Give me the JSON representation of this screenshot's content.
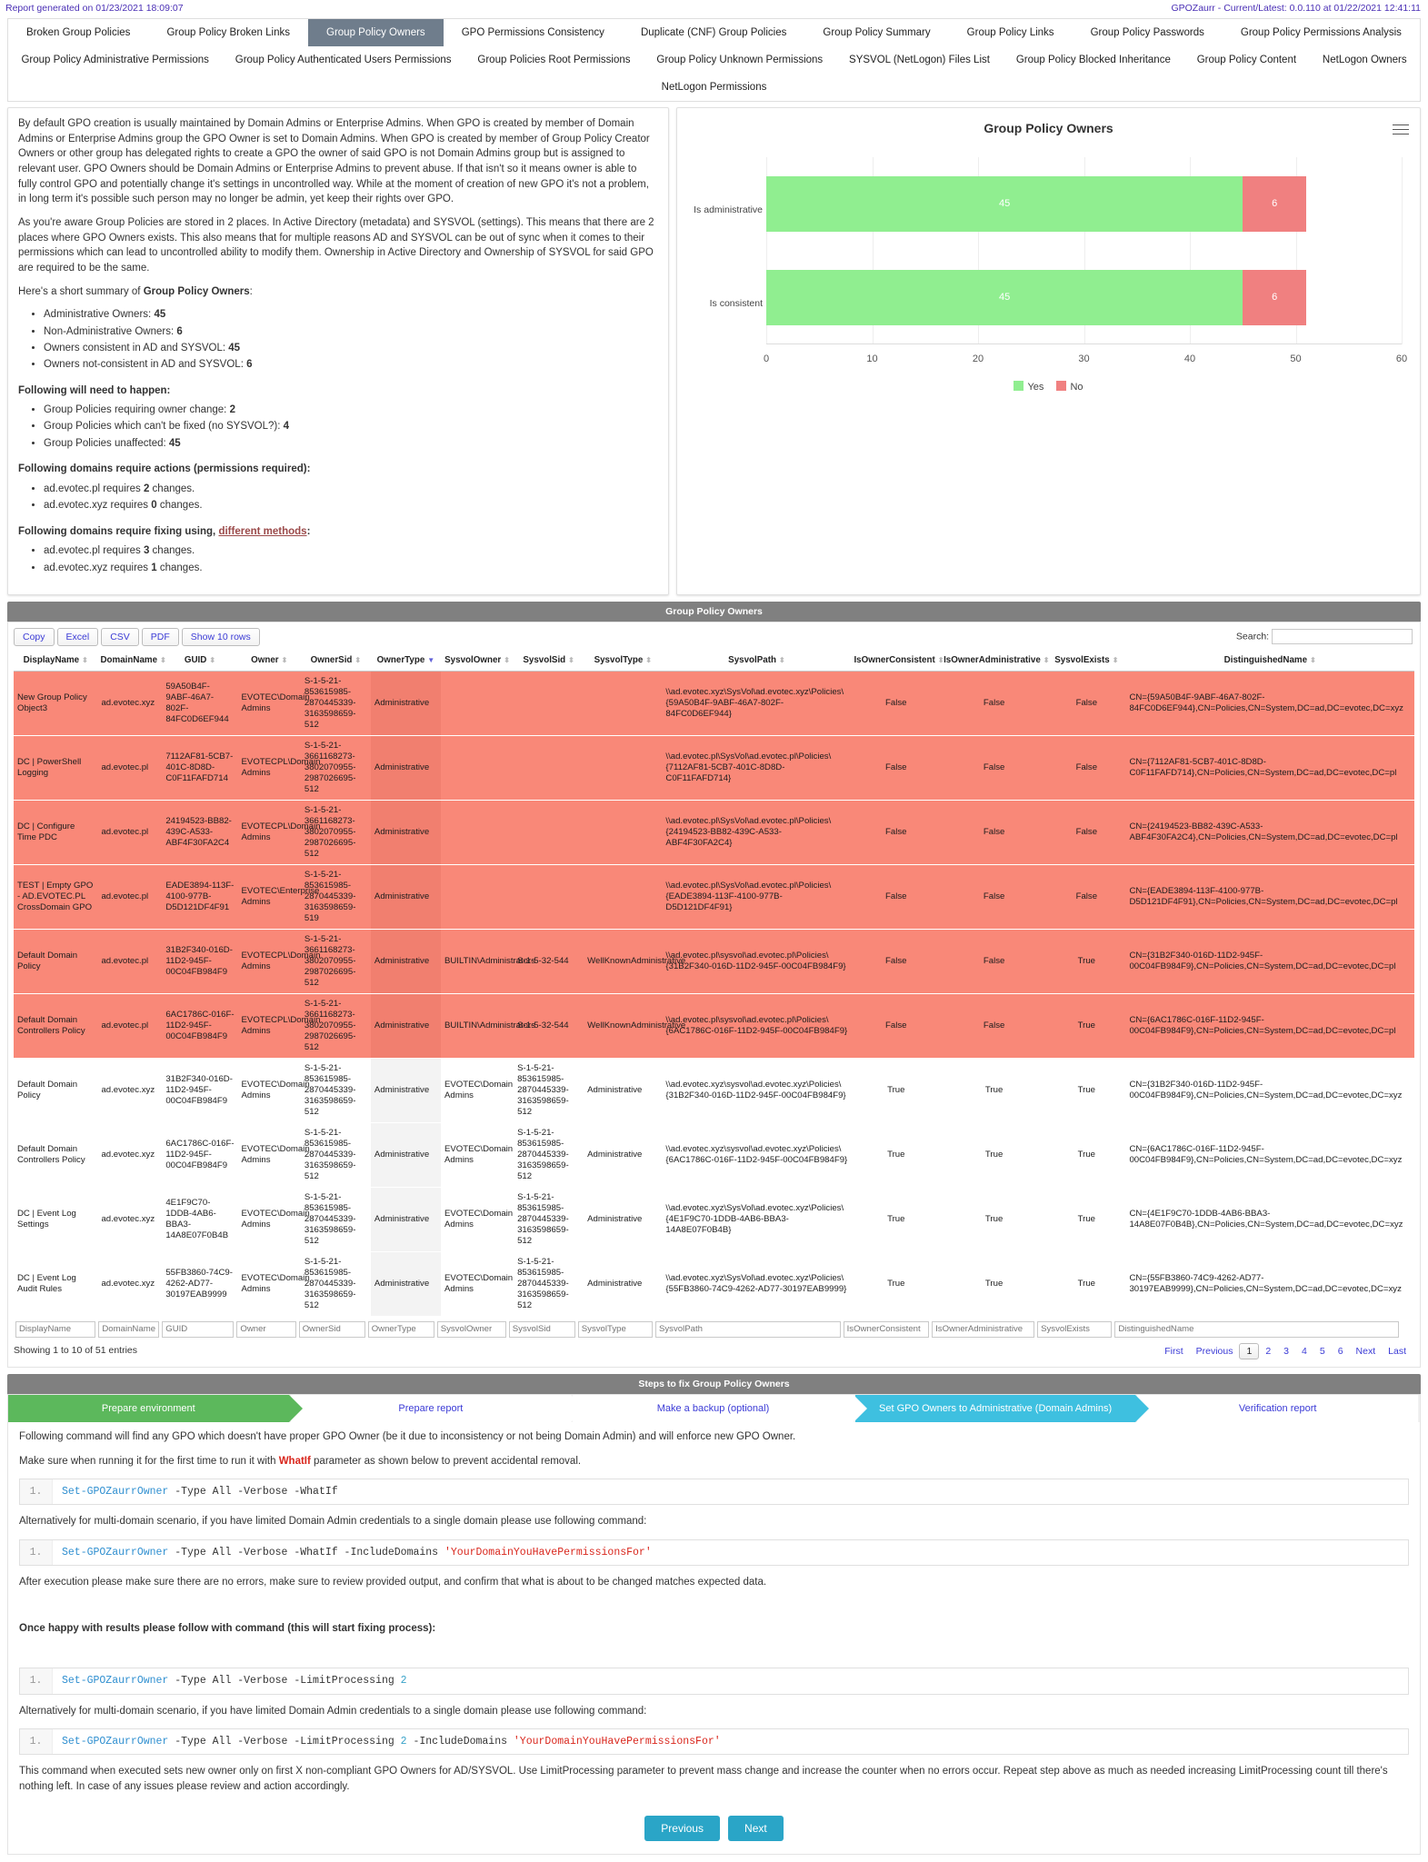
{
  "header": {
    "generated": "Report generated on 01/23/2021 18:09:07",
    "version": "GPOZaurr - Current/Latest: 0.0.110 at 01/22/2021 12:41:11"
  },
  "tabs": {
    "row1": [
      "Broken Group Policies",
      "Group Policy Broken Links",
      "Group Policy Owners",
      "GPO Permissions Consistency",
      "Duplicate (CNF) Group Policies",
      "Group Policy Summary",
      "Group Policy Links",
      "Group Policy Passwords",
      "Group Policy Permissions Analysis"
    ],
    "row2": [
      "Group Policy Administrative Permissions",
      "Group Policy Authenticated Users Permissions",
      "Group Policies Root Permissions",
      "Group Policy Unknown Permissions",
      "SYSVOL (NetLogon) Files List",
      "Group Policy Blocked Inheritance",
      "Group Policy Content",
      "NetLogon Owners"
    ],
    "row3": [
      "NetLogon Permissions"
    ],
    "active": "Group Policy Owners"
  },
  "description": {
    "p1": "By default GPO creation is usually maintained by Domain Admins or Enterprise Admins. When GPO is created by member of Domain Admins or Enterprise Admins group the GPO Owner is set to Domain Admins. When GPO is created by member of Group Policy Creator Owners or other group has delegated rights to create a GPO the owner of said GPO is not Domain Admins group but is assigned to relevant user. GPO Owners should be Domain Admins or Enterprise Admins to prevent abuse. If that isn't so it means owner is able to fully control GPO and potentially change it's settings in uncontrolled way. While at the moment of creation of new GPO it's not a problem, in long term it's possible such person may no longer be admin, yet keep their rights over GPO.",
    "p2": "As you're aware Group Policies are stored in 2 places. In Active Directory (metadata) and SYSVOL (settings). This means that there are 2 places where GPO Owners exists. This also means that for multiple reasons AD and SYSVOL can be out of sync when it comes to their permissions which can lead to uncontrolled ability to modify them. Ownership in Active Directory and Ownership of SYSVOL for said GPO are required to be the same.",
    "summary_lead": "Here's a short summary of ",
    "summary_bold": "Group Policy Owners",
    "summary_tail": ":",
    "summary_items": [
      {
        "label": "Administrative Owners: ",
        "value": "45"
      },
      {
        "label": "Non-Administrative Owners: ",
        "value": "6"
      },
      {
        "label": "Owners consistent in AD and SYSVOL: ",
        "value": "45"
      },
      {
        "label": "Owners not-consistent in AD and SYSVOL: ",
        "value": "6"
      }
    ],
    "happen_title": "Following will need to happen:",
    "happen_items": [
      {
        "label": "Group Policies requiring owner change: ",
        "value": "2"
      },
      {
        "label": "Group Policies which can't be fixed (no SYSVOL?): ",
        "value": "4"
      },
      {
        "label": "Group Policies unaffected: ",
        "value": "45"
      }
    ],
    "actions_title": "Following domains require actions (permissions required):",
    "actions_items": [
      {
        "pre": "ad.evotec.pl requires ",
        "value": "2",
        "post": " changes."
      },
      {
        "pre": "ad.evotec.xyz requires ",
        "value": "0",
        "post": " changes."
      }
    ],
    "fixing_title_pre": "Following domains require fixing using, ",
    "fixing_title_link": "different methods",
    "fixing_title_post": ":",
    "fixing_items": [
      {
        "pre": "ad.evotec.pl requires ",
        "value": "3",
        "post": " changes."
      },
      {
        "pre": "ad.evotec.xyz requires ",
        "value": "1",
        "post": " changes."
      }
    ]
  },
  "chart_data": {
    "type": "bar",
    "orientation": "horizontal",
    "stacked": true,
    "title": "Group Policy Owners",
    "categories": [
      "Is administrative",
      "Is consistent"
    ],
    "series": [
      {
        "name": "Yes",
        "color": "#90ee90",
        "values": [
          45,
          45
        ]
      },
      {
        "name": "No",
        "color": "#f08080",
        "values": [
          6,
          6
        ]
      }
    ],
    "xlabel": "",
    "ylabel": "",
    "xlim": [
      0,
      60
    ],
    "xticks": [
      0,
      10,
      20,
      30,
      40,
      50,
      60
    ],
    "grid": true,
    "legend_position": "bottom",
    "data_labels": [
      [
        "45",
        "6"
      ],
      [
        "45",
        "6"
      ]
    ]
  },
  "table": {
    "section_title": "Group Policy Owners",
    "buttons": [
      "Copy",
      "Excel",
      "CSV",
      "PDF",
      "Show 10 rows"
    ],
    "search_label": "Search:",
    "search_value": "",
    "columns": [
      "DisplayName",
      "DomainName",
      "GUID",
      "Owner",
      "OwnerSid",
      "OwnerType",
      "SysvolOwner",
      "SysvolSid",
      "SysvolType",
      "SysvolPath",
      "IsOwnerConsistent",
      "IsOwnerAdministrative",
      "SysvolExists",
      "DistinguishedName"
    ],
    "sorted_column": "OwnerType",
    "rows": [
      {
        "state": "bad",
        "cells": [
          "New Group Policy Object3",
          "ad.evotec.xyz",
          "59A50B4F-9ABF-46A7-802F-84FC0D6EF944",
          "EVOTEC\\Domain Admins",
          "S-1-5-21-853615985-2870445339-3163598659-512",
          "Administrative",
          "",
          "",
          "",
          "\\\\ad.evotec.xyz\\SysVol\\ad.evotec.xyz\\Policies\\{59A50B4F-9ABF-46A7-802F-84FC0D6EF944}",
          "False",
          "False",
          "False",
          "CN={59A50B4F-9ABF-46A7-802F-84FC0D6EF944},CN=Policies,CN=System,DC=ad,DC=evotec,DC=xyz"
        ]
      },
      {
        "state": "bad",
        "cells": [
          "DC | PowerShell Logging",
          "ad.evotec.pl",
          "7112AF81-5CB7-401C-8D8D-C0F11FAFD714",
          "EVOTECPL\\Domain Admins",
          "S-1-5-21-3661168273-3802070955-2987026695-512",
          "Administrative",
          "",
          "",
          "",
          "\\\\ad.evotec.pl\\SysVol\\ad.evotec.pl\\Policies\\{7112AF81-5CB7-401C-8D8D-C0F11FAFD714}",
          "False",
          "False",
          "False",
          "CN={7112AF81-5CB7-401C-8D8D-C0F11FAFD714},CN=Policies,CN=System,DC=ad,DC=evotec,DC=pl"
        ]
      },
      {
        "state": "bad",
        "cells": [
          "DC | Configure Time PDC",
          "ad.evotec.pl",
          "24194523-BB82-439C-A533-ABF4F30FA2C4",
          "EVOTECPL\\Domain Admins",
          "S-1-5-21-3661168273-3802070955-2987026695-512",
          "Administrative",
          "",
          "",
          "",
          "\\\\ad.evotec.pl\\SysVol\\ad.evotec.pl\\Policies\\{24194523-BB82-439C-A533-ABF4F30FA2C4}",
          "False",
          "False",
          "False",
          "CN={24194523-BB82-439C-A533-ABF4F30FA2C4},CN=Policies,CN=System,DC=ad,DC=evotec,DC=pl"
        ]
      },
      {
        "state": "bad",
        "cells": [
          "TEST | Empty GPO - AD.EVOTEC.PL CrossDomain GPO",
          "ad.evotec.pl",
          "EADE3894-113F-4100-977B-D5D121DF4F91",
          "EVOTEC\\Enterprise Admins",
          "S-1-5-21-853615985-2870445339-3163598659-519",
          "Administrative",
          "",
          "",
          "",
          "\\\\ad.evotec.pl\\SysVol\\ad.evotec.pl\\Policies\\{EADE3894-113F-4100-977B-D5D121DF4F91}",
          "False",
          "False",
          "False",
          "CN={EADE3894-113F-4100-977B-D5D121DF4F91},CN=Policies,CN=System,DC=ad,DC=evotec,DC=pl"
        ]
      },
      {
        "state": "bad",
        "cells": [
          "Default Domain Policy",
          "ad.evotec.pl",
          "31B2F340-016D-11D2-945F-00C04FB984F9",
          "EVOTECPL\\Domain Admins",
          "S-1-5-21-3661168273-3802070955-2987026695-512",
          "Administrative",
          "BUILTIN\\Administrators",
          "S-1-5-32-544",
          "WellKnownAdministrative",
          "\\\\ad.evotec.pl\\sysvol\\ad.evotec.pl\\Policies\\{31B2F340-016D-11D2-945F-00C04FB984F9}",
          "False",
          "False",
          "True",
          "CN={31B2F340-016D-11D2-945F-00C04FB984F9},CN=Policies,CN=System,DC=ad,DC=evotec,DC=pl"
        ]
      },
      {
        "state": "bad",
        "cells": [
          "Default Domain Controllers Policy",
          "ad.evotec.pl",
          "6AC1786C-016F-11D2-945F-00C04FB984F9",
          "EVOTECPL\\Domain Admins",
          "S-1-5-21-3661168273-3802070955-2987026695-512",
          "Administrative",
          "BUILTIN\\Administrators",
          "S-1-5-32-544",
          "WellKnownAdministrative",
          "\\\\ad.evotec.pl\\sysvol\\ad.evotec.pl\\Policies\\{6AC1786C-016F-11D2-945F-00C04FB984F9}",
          "False",
          "False",
          "True",
          "CN={6AC1786C-016F-11D2-945F-00C04FB984F9},CN=Policies,CN=System,DC=ad,DC=evotec,DC=pl"
        ]
      },
      {
        "state": "ok",
        "cells": [
          "Default Domain Policy",
          "ad.evotec.xyz",
          "31B2F340-016D-11D2-945F-00C04FB984F9",
          "EVOTEC\\Domain Admins",
          "S-1-5-21-853615985-2870445339-3163598659-512",
          "Administrative",
          "EVOTEC\\Domain Admins",
          "S-1-5-21-853615985-2870445339-3163598659-512",
          "Administrative",
          "\\\\ad.evotec.xyz\\sysvol\\ad.evotec.xyz\\Policies\\{31B2F340-016D-11D2-945F-00C04FB984F9}",
          "True",
          "True",
          "True",
          "CN={31B2F340-016D-11D2-945F-00C04FB984F9},CN=Policies,CN=System,DC=ad,DC=evotec,DC=xyz"
        ]
      },
      {
        "state": "ok",
        "cells": [
          "Default Domain Controllers Policy",
          "ad.evotec.xyz",
          "6AC1786C-016F-11D2-945F-00C04FB984F9",
          "EVOTEC\\Domain Admins",
          "S-1-5-21-853615985-2870445339-3163598659-512",
          "Administrative",
          "EVOTEC\\Domain Admins",
          "S-1-5-21-853615985-2870445339-3163598659-512",
          "Administrative",
          "\\\\ad.evotec.xyz\\sysvol\\ad.evotec.xyz\\Policies\\{6AC1786C-016F-11D2-945F-00C04FB984F9}",
          "True",
          "True",
          "True",
          "CN={6AC1786C-016F-11D2-945F-00C04FB984F9},CN=Policies,CN=System,DC=ad,DC=evotec,DC=xyz"
        ]
      },
      {
        "state": "ok",
        "cells": [
          "DC | Event Log Settings",
          "ad.evotec.xyz",
          "4E1F9C70-1DDB-4AB6-BBA3-14A8E07F0B4B",
          "EVOTEC\\Domain Admins",
          "S-1-5-21-853615985-2870445339-3163598659-512",
          "Administrative",
          "EVOTEC\\Domain Admins",
          "S-1-5-21-853615985-2870445339-3163598659-512",
          "Administrative",
          "\\\\ad.evotec.xyz\\SysVol\\ad.evotec.xyz\\Policies\\{4E1F9C70-1DDB-4AB6-BBA3-14A8E07F0B4B}",
          "True",
          "True",
          "True",
          "CN={4E1F9C70-1DDB-4AB6-BBA3-14A8E07F0B4B},CN=Policies,CN=System,DC=ad,DC=evotec,DC=xyz"
        ]
      },
      {
        "state": "ok",
        "cells": [
          "DC | Event Log Audit Rules",
          "ad.evotec.xyz",
          "55FB3860-74C9-4262-AD77-30197EAB9999",
          "EVOTEC\\Domain Admins",
          "S-1-5-21-853615985-2870445339-3163598659-512",
          "Administrative",
          "EVOTEC\\Domain Admins",
          "S-1-5-21-853615985-2870445339-3163598659-512",
          "Administrative",
          "\\\\ad.evotec.xyz\\SysVol\\ad.evotec.xyz\\Policies\\{55FB3860-74C9-4262-AD77-30197EAB9999}",
          "True",
          "True",
          "True",
          "CN={55FB3860-74C9-4262-AD77-30197EAB9999},CN=Policies,CN=System,DC=ad,DC=evotec,DC=xyz"
        ]
      }
    ],
    "info": "Showing 1 to 10 of 51 entries",
    "pager": [
      "First",
      "Previous",
      "1",
      "2",
      "3",
      "4",
      "5",
      "6",
      "Next",
      "Last"
    ],
    "pager_current": "1"
  },
  "steps": {
    "section_title": "Steps to fix Group Policy Owners",
    "wizard": [
      {
        "label": "Prepare environment",
        "state": "done"
      },
      {
        "label": "Prepare report",
        "state": "plain"
      },
      {
        "label": "Make a backup (optional)",
        "state": "plain"
      },
      {
        "label": "Set GPO Owners to Administrative (Domain Admins)",
        "state": "active"
      },
      {
        "label": "Verification report",
        "state": "plain"
      }
    ],
    "para1": "Following command will find any GPO which doesn't have proper GPO Owner (be it due to inconsistency or not being Domain Admin) and will enforce new GPO Owner.",
    "para2_pre": "Make sure when running it for the first time to run it with ",
    "para2_whatif": "WhatIf",
    "para2_post": " parameter as shown below to prevent accidental removal.",
    "code1_line": "1.",
    "code1_cmd": "Set-GPOZaurrOwner",
    "code1_rest": " -Type All -Verbose -WhatIf",
    "para3": "Alternatively for multi-domain scenario, if you have limited Domain Admin credentials to a single domain please use following command:",
    "code2_line": "1.",
    "code2_cmd": "Set-GPOZaurrOwner",
    "code2_rest": " -Type All -Verbose -WhatIf -IncludeDomains ",
    "code2_str": "'YourDomainYouHavePermissionsFor'",
    "para4": "After execution please make sure there are no errors, make sure to review provided output, and confirm that what is about to be changed matches expected data.",
    "para5": "Once happy with results please follow with command (this will start fixing process):",
    "code3_line": "1.",
    "code3_cmd": "Set-GPOZaurrOwner",
    "code3_rest": " -Type All -Verbose -LimitProcessing ",
    "code3_num": "2",
    "para6": "Alternatively for multi-domain scenario, if you have limited Domain Admin credentials to a single domain please use following command:",
    "code4_line": "1.",
    "code4_cmd": "Set-GPOZaurrOwner",
    "code4_rest": " -Type All -Verbose -LimitProcessing ",
    "code4_num": "2",
    "code4_rest2": " -IncludeDomains ",
    "code4_str": "'YourDomainYouHavePermissionsFor'",
    "para7": "This command when executed sets new owner only on first X non-compliant GPO Owners for AD/SYSVOL. Use LimitProcessing parameter to prevent mass change and increase the counter when no errors occur. Repeat step above as much as needed increasing LimitProcessing count till there's nothing left. In case of any issues please review and action accordingly.",
    "prev_label": "Previous",
    "next_label": "Next"
  }
}
